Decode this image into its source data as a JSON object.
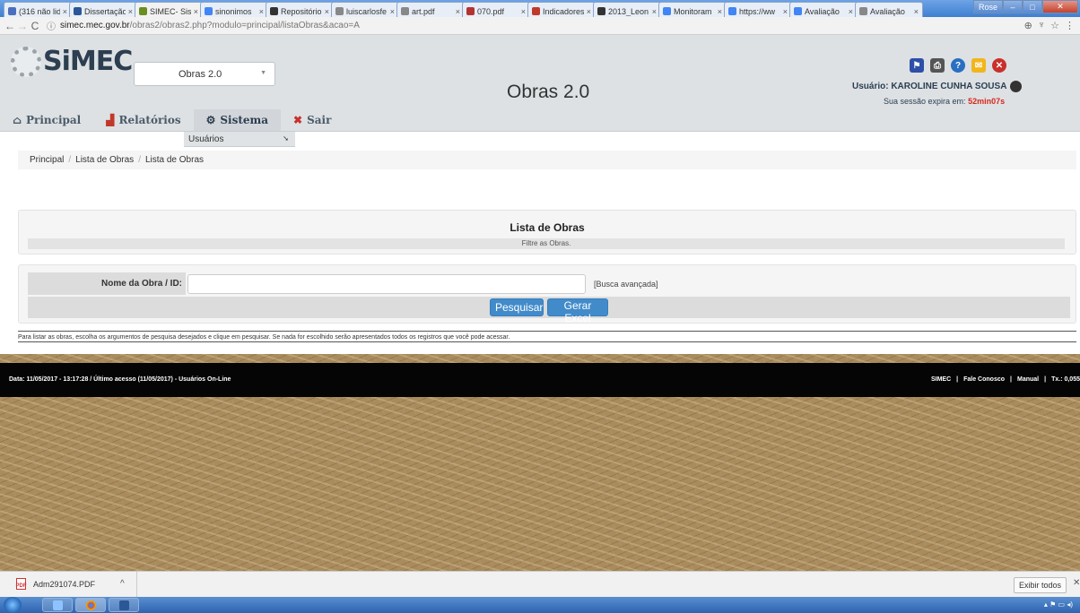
{
  "browser": {
    "tabs": [
      {
        "label": "(316 não lid",
        "icon": "mail-icon",
        "color": "#4b6fbf"
      },
      {
        "label": "Dissertação",
        "icon": "word-icon",
        "color": "#2b5797"
      },
      {
        "label": "SIMEC- Sist",
        "icon": "simec-icon",
        "color": "#6b8e23",
        "active": true
      },
      {
        "label": "sinonimos",
        "icon": "google-icon",
        "color": "#4285f4"
      },
      {
        "label": "Repositório",
        "icon": "doc-icon",
        "color": "#333333"
      },
      {
        "label": "luiscarlosfe",
        "icon": "file-icon",
        "color": "#888888"
      },
      {
        "label": "art.pdf",
        "icon": "file-icon",
        "color": "#888888"
      },
      {
        "label": "070.pdf",
        "icon": "pdf-icon",
        "color": "#b33333"
      },
      {
        "label": "Indicadores",
        "icon": "rsp-icon",
        "color": "#c0392b"
      },
      {
        "label": "2013_Leon",
        "icon": "doc-icon",
        "color": "#333333"
      },
      {
        "label": "Monitoram",
        "icon": "google-icon",
        "color": "#4285f4"
      },
      {
        "label": "https://ww",
        "icon": "google-icon",
        "color": "#4285f4"
      },
      {
        "label": "Avaliação",
        "icon": "google-icon",
        "color": "#4285f4"
      },
      {
        "label": "Avaliação",
        "icon": "file-icon",
        "color": "#888888"
      }
    ],
    "url_host": "simec.mec.gov.br",
    "url_path": "/obras2/obras2.php?modulo=principal/listaObras&acao=A",
    "profile_label": "Rose"
  },
  "header": {
    "logo_text": "SiMEC",
    "system_select": "Obras 2.0",
    "app_title": "Obras 2.0",
    "user_label": "Usuário: KAROLINE CUNHA SOUSA",
    "session_label": "Sua sessão expira em:",
    "session_time": "52min07s"
  },
  "menu": {
    "items": [
      {
        "label": "Principal",
        "icon": "home-icon"
      },
      {
        "label": "Relatórios",
        "icon": "chart-icon"
      },
      {
        "label": "Sistema",
        "icon": "gear-icon"
      },
      {
        "label": "Sair",
        "icon": "exit-icon"
      }
    ],
    "dropdown_item": "Usuários"
  },
  "breadcrumb": [
    "Principal",
    "Lista de Obras",
    "Lista de Obras"
  ],
  "panel": {
    "title": "Lista de Obras",
    "subtitle": "Filtre as Obras."
  },
  "form": {
    "name_label": "Nome da Obra / ID:",
    "name_value": "",
    "advanced_link": "[Busca avançada]",
    "search_button": "Pesquisar",
    "excel_button": "Gerar Excel"
  },
  "hint": "Para listar as obras, escolha os argumentos de pesquisa desejados e clique em pesquisar. Se nada for escolhido serão apresentados todos os registros que você pode acessar.",
  "footer": {
    "left": "Data: 11/05/2017 - 13:17:28 / Último acesso (11/05/2017) - Usuários On-Line",
    "links": [
      "SIMEC",
      "|",
      "Fale Conosco",
      "|",
      "Manual",
      "|",
      "Tx.: 0,055"
    ]
  },
  "downloads": {
    "file_name": "Adm291074.PDF",
    "show_all": "Exibir todos"
  }
}
